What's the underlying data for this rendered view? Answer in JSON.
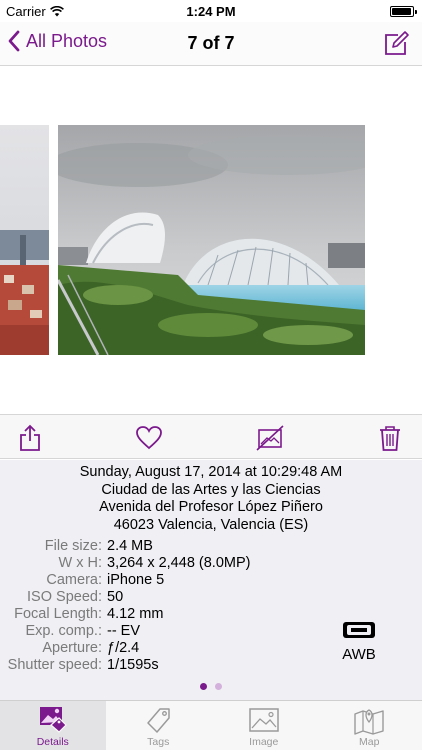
{
  "status_bar": {
    "carrier": "Carrier",
    "time": "1:24 PM"
  },
  "nav": {
    "back_label": "All Photos",
    "title": "7 of 7"
  },
  "photo": {
    "description_icons": [
      "share-icon",
      "heart-icon",
      "hide-icon",
      "trash-icon"
    ]
  },
  "summary": {
    "date": "Sunday, August 17, 2014 at 10:29:48 AM",
    "place": "Ciudad de las Artes y las Ciencias",
    "street": "Avenida del Profesor López Piñero",
    "city": "46023 Valencia, Valencia (ES)"
  },
  "metadata": [
    {
      "label": "File size:",
      "value": "2.4 MB"
    },
    {
      "label": "W x H:",
      "value": "3,264 x 2,448 (8.0MP)"
    },
    {
      "label": "Camera:",
      "value": "iPhone 5"
    },
    {
      "label": "ISO Speed:",
      "value": "50"
    },
    {
      "label": "Focal Length:",
      "value": "4.12 mm"
    },
    {
      "label": "Exp. comp.:",
      "value": "-- EV"
    },
    {
      "label": "Aperture:",
      "value": "ƒ/2.4"
    },
    {
      "label": "Shutter speed:",
      "value": "1/1595s"
    }
  ],
  "white_balance": {
    "label": "AWB"
  },
  "pager": {
    "pages": 2,
    "current": 1
  },
  "tabs": [
    {
      "label": "Details",
      "icon": "photo-info-icon",
      "active": true
    },
    {
      "label": "Tags",
      "icon": "tag-icon",
      "active": false
    },
    {
      "label": "Image",
      "icon": "image-icon",
      "active": false
    },
    {
      "label": "Map",
      "icon": "map-icon",
      "active": false
    }
  ],
  "colors": {
    "accent": "#7b1a8c",
    "inactive": "#9a9a9a",
    "dot_active": "#7b1a8c",
    "dot_inactive": "#d4b0dc"
  }
}
